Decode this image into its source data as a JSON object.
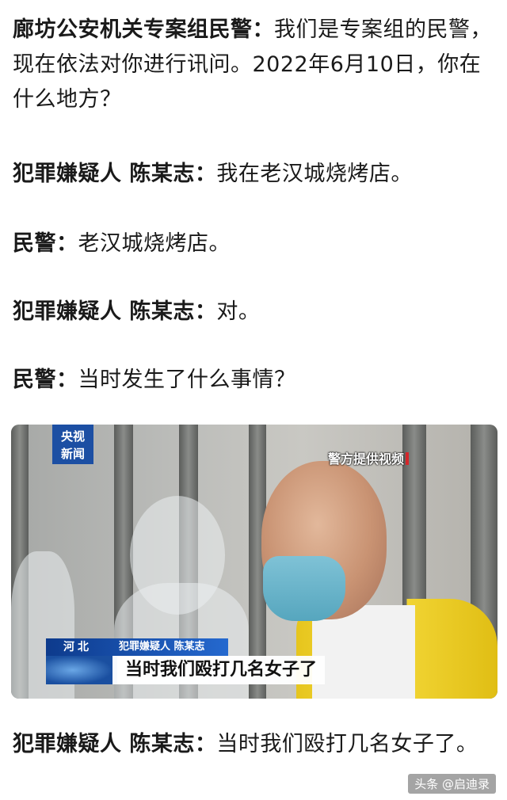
{
  "dialogue": [
    {
      "speaker": "廊坊公安机关专案组民警：",
      "text": "我们是专案组的民警，现在依法对你进行讯问。2022年6月10日，你在什么地方？"
    },
    {
      "speaker": "犯罪嫌疑人 陈某志：",
      "text": "我在老汉城烧烤店。"
    },
    {
      "speaker": "民警：",
      "text": "老汉城烧烤店。"
    },
    {
      "speaker": "犯罪嫌疑人 陈某志：",
      "text": "对。"
    },
    {
      "speaker": "民警：",
      "text": "当时发生了什么事情？"
    }
  ],
  "video": {
    "logo_line1": "央视",
    "logo_line2": "新闻",
    "watermark": "警方提供视频",
    "lower_third": {
      "region": "河北",
      "role": "犯罪嫌疑人 陈某志",
      "caption": "当时我们殴打几名女子了"
    },
    "colors": {
      "brand_blue": "#1c4fa3",
      "vest_yellow": "#f1d433",
      "mask_blue": "#7fc2d6"
    }
  },
  "closing": {
    "speaker": "犯罪嫌疑人 陈某志：",
    "text": "当时我们殴打几名女子了。"
  },
  "footer": {
    "source": "头条 @启迪录"
  }
}
